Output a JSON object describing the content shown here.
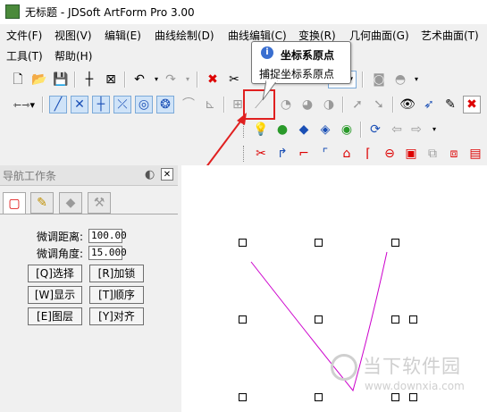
{
  "window": {
    "title": "无标题 - JDSoft ArtForm Pro 3.00"
  },
  "menu": {
    "row1": [
      "文件(F)",
      "视图(V)",
      "编辑(E)",
      "曲线绘制(D)",
      "曲线编辑(C)",
      "变换(R)",
      "几何曲面(G)",
      "艺术曲面(T)"
    ],
    "row2": [
      "工具(T)",
      "帮助(H)"
    ]
  },
  "tooltip": {
    "title": "坐标系原点",
    "description": "捕捉坐标系原点"
  },
  "nav_panel": {
    "title": "导航工作条",
    "fine_distance_label": "微调距离:",
    "fine_distance_value": "100.00",
    "fine_angle_label": "微调角度:",
    "fine_angle_value": "15.000",
    "buttons": [
      "[Q]选择",
      "[R]加锁",
      "[W]显示",
      "[T]顺序",
      "[E]图层",
      "[Y]对齐"
    ]
  },
  "watermark": {
    "name": "当下软件园",
    "url": "www.downxia.com"
  },
  "colors": {
    "highlight": "#e02020",
    "curve": "#cc00cc",
    "selection": "#cfe3f8"
  }
}
